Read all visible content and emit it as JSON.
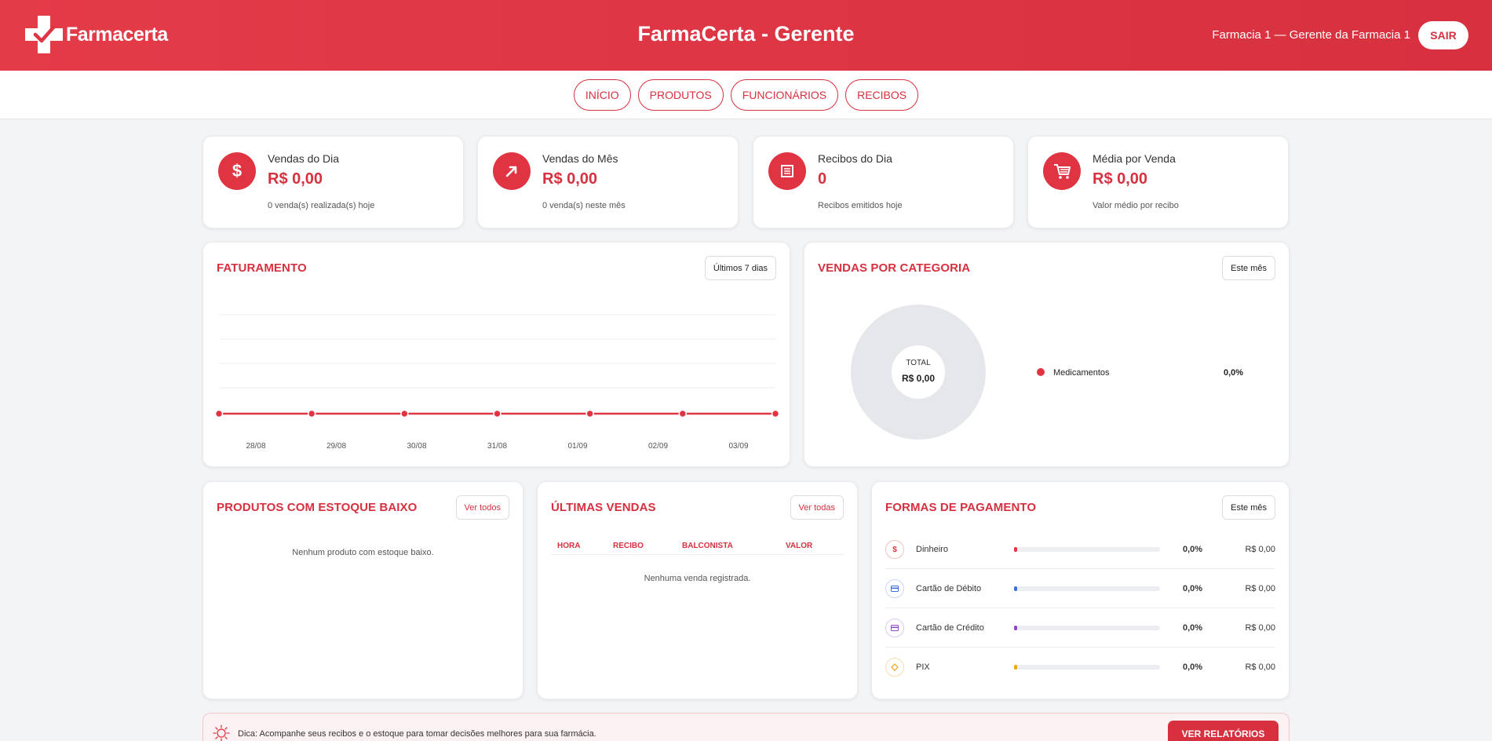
{
  "header": {
    "logo_text": "Farmacerta",
    "title": "FarmaCerta - Gerente",
    "user_info": "Farmacia 1 — Gerente da Farmacia 1",
    "logout_label": "SAIR",
    "brand_color": "#d7303f"
  },
  "nav": {
    "items": [
      {
        "label": "INÍCIO"
      },
      {
        "label": "PRODUTOS"
      },
      {
        "label": "FUNCIONÁRIOS"
      },
      {
        "label": "RECIBOS"
      }
    ]
  },
  "stats": [
    {
      "icon": "dollar-icon",
      "label": "Vendas do Dia",
      "value": "R$ 0,00",
      "sub": "0 venda(s) realizada(s) hoje"
    },
    {
      "icon": "trend-up-icon",
      "label": "Vendas do Mês",
      "value": "R$ 0,00",
      "sub": "0 venda(s) neste mês"
    },
    {
      "icon": "receipt-icon",
      "label": "Recibos do Dia",
      "value": "0",
      "sub": "Recibos emitidos hoje"
    },
    {
      "icon": "cart-icon",
      "label": "Média por Venda",
      "value": "R$ 0,00",
      "sub": "Valor médio por recibo"
    }
  ],
  "revenue": {
    "title": "FATURAMENTO",
    "filter_label": "Últimos 7 dias"
  },
  "chart_data": [
    {
      "type": "line",
      "title": "FATURAMENTO",
      "x": [
        "28/08",
        "29/08",
        "30/08",
        "31/08",
        "01/09",
        "02/09",
        "03/09"
      ],
      "series": [
        {
          "values": [
            0,
            0,
            0,
            0,
            0,
            0,
            0
          ],
          "color": "#e03442"
        }
      ],
      "grid": true
    },
    {
      "type": "pie",
      "title": "VENDAS POR CATEGORIA",
      "center_label": "TOTAL",
      "center_value": "R$ 0,00",
      "categories": [
        "Medicamentos"
      ],
      "values": [
        0
      ],
      "percent_labels": [
        "0,0%"
      ],
      "colors": [
        "#e03442"
      ],
      "empty_ring_color": "#e5e7eb"
    }
  ],
  "categories": {
    "title": "VENDAS POR CATEGORIA",
    "filter_label": "Este mês"
  },
  "low_stock": {
    "title": "PRODUTOS COM ESTOQUE BAIXO",
    "link_label": "Ver todos",
    "empty_message": "Nenhum produto com estoque baixo."
  },
  "recent_sales": {
    "title": "ÚLTIMAS VENDAS",
    "link_label": "Ver todas",
    "columns": [
      "HORA",
      "RECIBO",
      "BALCONISTA",
      "VALOR"
    ],
    "empty_message": "Nenhuma venda registrada."
  },
  "payments": {
    "title": "FORMAS DE PAGAMENTO",
    "filter_label": "Este mês",
    "rows": [
      {
        "icon": "dollar-icon",
        "name": "Dinheiro",
        "percent": "0,0%",
        "amount": "R$ 0,00",
        "fraction": 0,
        "color": "#e03442"
      },
      {
        "icon": "debit-card-icon",
        "name": "Cartão de Débito",
        "percent": "0,0%",
        "amount": "R$ 0,00",
        "fraction": 0,
        "color": "#3b6fd8"
      },
      {
        "icon": "credit-card-icon",
        "name": "Cartão de Crédito",
        "percent": "0,0%",
        "amount": "R$ 0,00",
        "fraction": 0,
        "color": "#8b49c8"
      },
      {
        "icon": "pix-icon",
        "name": "PIX",
        "percent": "0,0%",
        "amount": "R$ 0,00",
        "fraction": 0,
        "color": "#f0a419"
      }
    ]
  },
  "tip": {
    "text": "Dica: Acompanhe seus recibos e o estoque para tomar decisões melhores para sua farmácia.",
    "button_label": "VER RELATÓRIOS"
  }
}
